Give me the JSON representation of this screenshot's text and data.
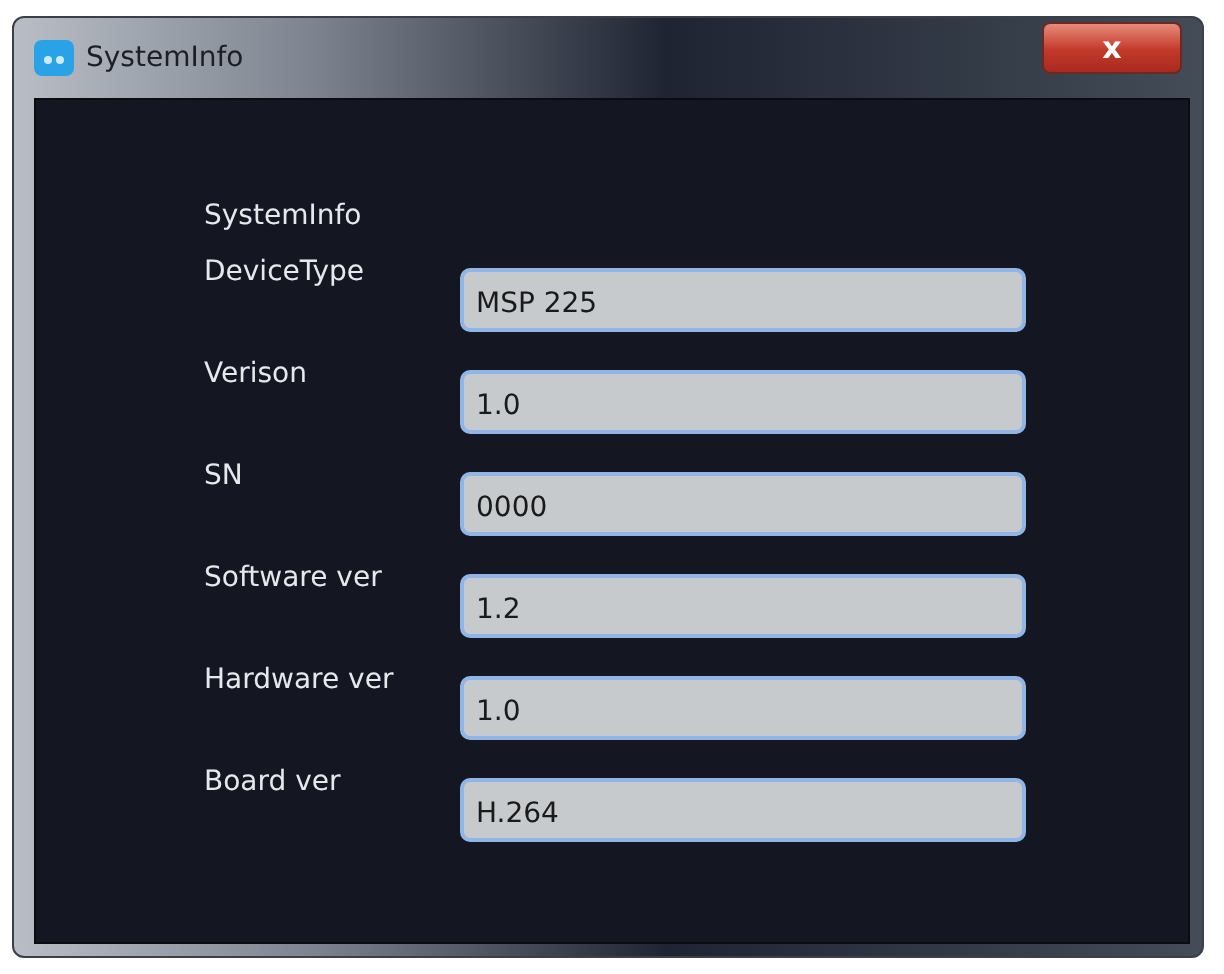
{
  "window": {
    "title": "SystemInfo",
    "close": "x"
  },
  "section_title": "SystemInfo",
  "fields": [
    {
      "label": "DeviceType",
      "value": "MSP 225"
    },
    {
      "label": "Verison",
      "value": "1.0"
    },
    {
      "label": "SN",
      "value": "0000"
    },
    {
      "label": "Software ver",
      "value": "1.2"
    },
    {
      "label": "Hardware ver",
      "value": "1.0"
    },
    {
      "label": "Board ver",
      "value": "H.264"
    }
  ]
}
